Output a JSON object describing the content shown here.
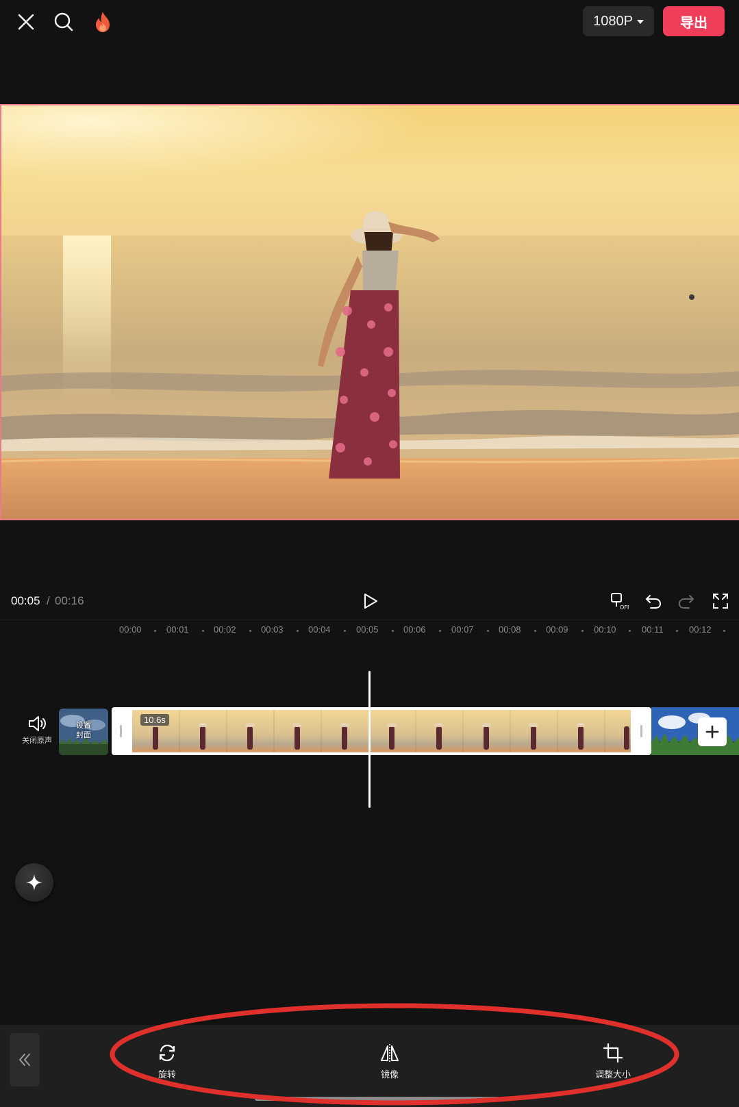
{
  "topbar": {
    "close_icon": "close-icon",
    "search_icon": "search-icon",
    "hot_icon": "flame-icon",
    "resolution_label": "1080P",
    "export_label": "导出",
    "export_color": "#f03d5a"
  },
  "player": {
    "current_time": "00:05",
    "separator": "/",
    "total_time": "00:16"
  },
  "ruler": {
    "ticks": [
      "00:00",
      "00:01",
      "00:02",
      "00:03",
      "00:04",
      "00:05",
      "00:06",
      "00:07",
      "00:08",
      "00:09",
      "00:10",
      "00:11",
      "00:12"
    ]
  },
  "track": {
    "mute_label": "关闭原声",
    "cover_label": "设置\n封面",
    "clip_duration": "10.6s"
  },
  "toolbar": {
    "items": [
      {
        "label": "旋转",
        "icon": "rotate-icon"
      },
      {
        "label": "镜像",
        "icon": "mirror-icon"
      },
      {
        "label": "调整大小",
        "icon": "crop-icon"
      }
    ]
  },
  "colors": {
    "accent": "#f03d5a",
    "annotation": "#e0302c"
  }
}
